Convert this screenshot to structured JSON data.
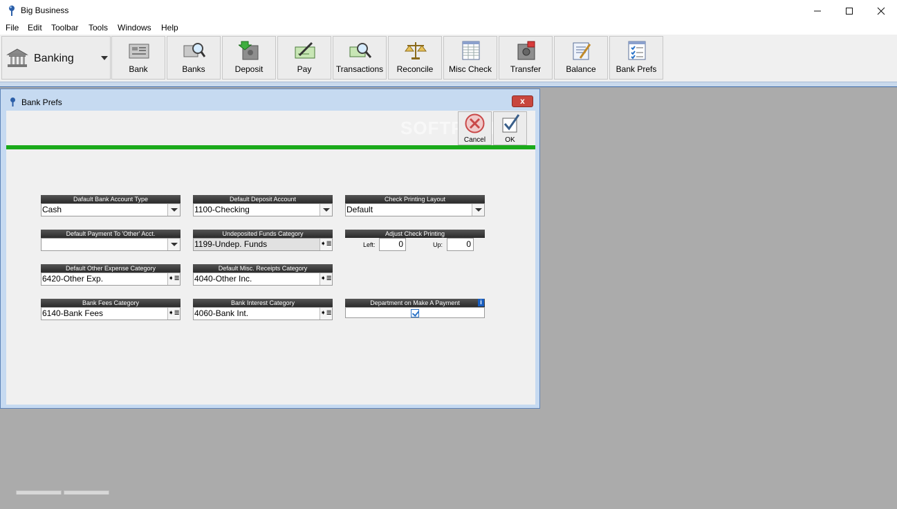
{
  "window": {
    "title": "Big Business"
  },
  "menu": [
    "File",
    "Edit",
    "Toolbar",
    "Tools",
    "Windows",
    "Help"
  ],
  "toolbar": {
    "module": "Banking",
    "buttons": [
      "Bank",
      "Banks",
      "Deposit",
      "Pay",
      "Transactions",
      "Reconcile",
      "Misc Check",
      "Transfer",
      "Balance",
      "Bank Prefs"
    ]
  },
  "dialog": {
    "title": "Bank Prefs",
    "close": "x",
    "cancel_label": "Cancel",
    "ok_label": "OK",
    "watermark": "SOFTPEDIA",
    "fields": {
      "default_bank_account_type": {
        "label": "Dafault Bank Account Type",
        "value": "Cash"
      },
      "default_deposit_account": {
        "label": "Default Deposit Account",
        "value": "1100-Checking"
      },
      "check_printing_layout": {
        "label": "Check Printing Layout",
        "value": "Default"
      },
      "default_payment_other": {
        "label": "Default Payment To 'Other' Acct.",
        "value": ""
      },
      "undeposited_funds": {
        "label": "Undeposited Funds Category",
        "value": "1199-Undep. Funds"
      },
      "adjust_check_printing": {
        "label": "Adjust Check Printing",
        "left_label": "Left:",
        "left_value": "0",
        "up_label": "Up:",
        "up_value": "0"
      },
      "default_other_expense": {
        "label": "Default Other Expense Category",
        "value": "6420-Other Exp."
      },
      "default_misc_receipts": {
        "label": "Default Misc. Receipts Category",
        "value": "4040-Other Inc."
      },
      "bank_fees": {
        "label": "Bank Fees Category",
        "value": "6140-Bank Fees"
      },
      "bank_interest": {
        "label": "Bank Interest Category",
        "value": "4060-Bank Int."
      },
      "department_payment": {
        "label": "Department on Make A Payment",
        "info": "i",
        "checked": true
      }
    }
  }
}
